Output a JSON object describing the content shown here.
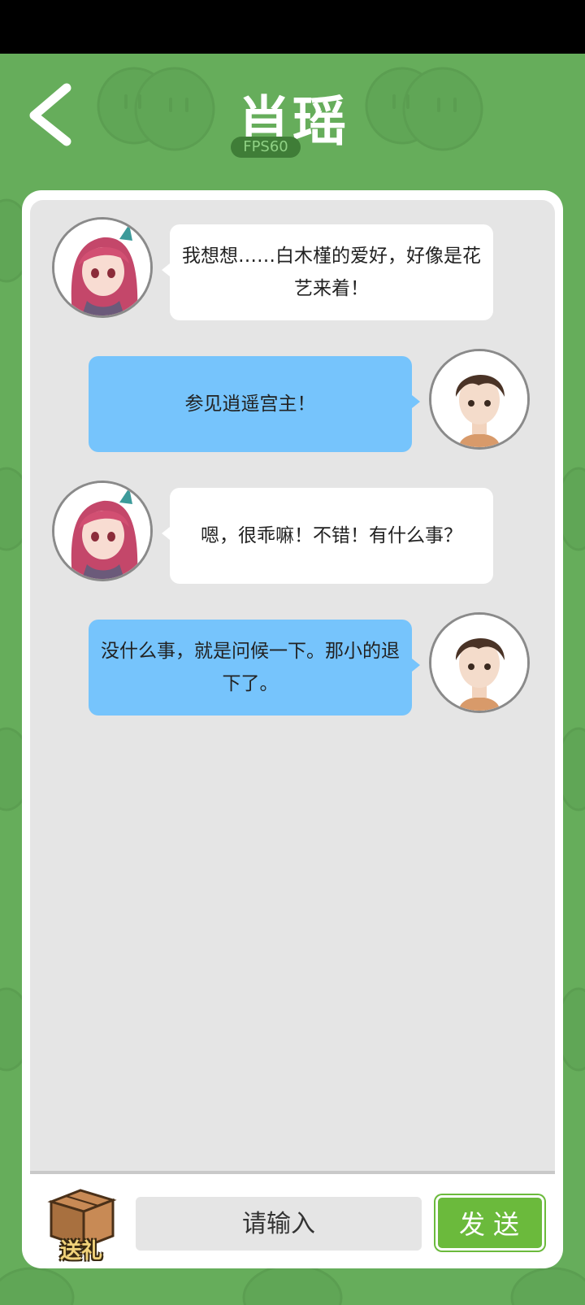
{
  "header": {
    "title": "肖瑶",
    "fps": "FPS60"
  },
  "messages": [
    {
      "side": "left",
      "speaker": "girl",
      "text": "我想想……白木槿的爱好，好像是花艺来着！"
    },
    {
      "side": "right",
      "speaker": "boy",
      "text": "参见逍遥宫主！"
    },
    {
      "side": "left",
      "speaker": "girl",
      "text": "嗯，很乖嘛！不错！有什么事？"
    },
    {
      "side": "right",
      "speaker": "boy",
      "text": "没什么事，就是问候一下。那小的退下了。"
    }
  ],
  "footer": {
    "gift_label": "送礼",
    "input_placeholder": "请输入",
    "send_label": "发送"
  },
  "colors": {
    "background": "#66ad5b",
    "player_bubble": "#76c4fc",
    "npc_bubble": "#ffffff",
    "send_button": "#6bba3c"
  }
}
